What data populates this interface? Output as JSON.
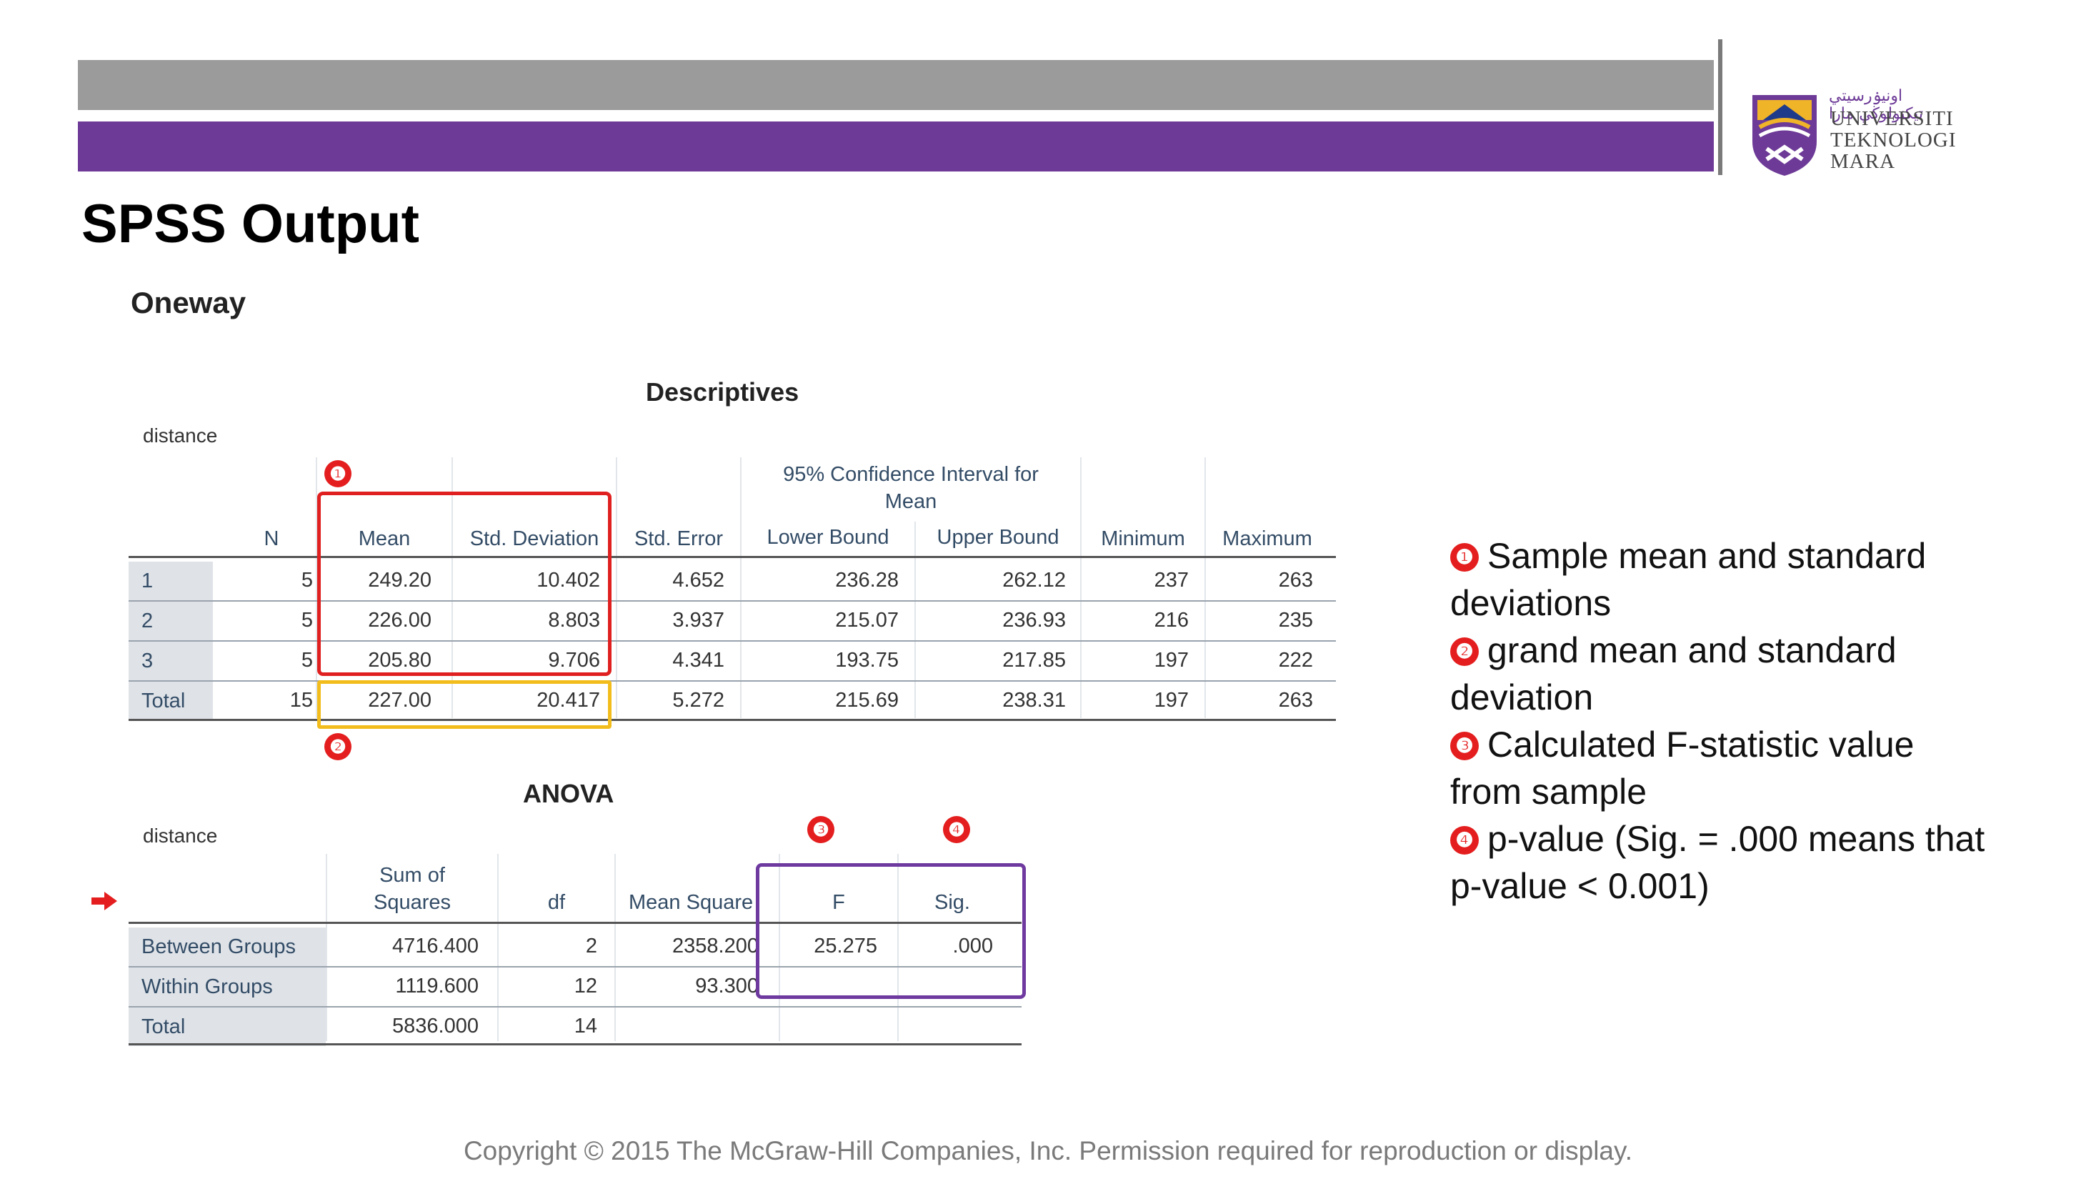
{
  "slide": {
    "title": "SPSS Output"
  },
  "logo": {
    "arabic": "اونيۏرسيتي تيكنولوڬي مارا",
    "line1": "UNIVERSITI",
    "line2": "TEKNOLOGI",
    "line3": "MARA"
  },
  "oneway": {
    "heading": "Oneway"
  },
  "descriptives": {
    "title": "Descriptives",
    "variable": "distance",
    "ci_header": [
      "95% Confidence Interval for",
      "Mean"
    ],
    "columns": [
      "N",
      "Mean",
      "Std. Deviation",
      "Std. Error",
      "Lower Bound",
      "Upper Bound",
      "Minimum",
      "Maximum"
    ],
    "rows": [
      {
        "label": "1",
        "cells": [
          "5",
          "249.20",
          "10.402",
          "4.652",
          "236.28",
          "262.12",
          "237",
          "263"
        ]
      },
      {
        "label": "2",
        "cells": [
          "5",
          "226.00",
          "8.803",
          "3.937",
          "215.07",
          "236.93",
          "216",
          "235"
        ]
      },
      {
        "label": "3",
        "cells": [
          "5",
          "205.80",
          "9.706",
          "4.341",
          "193.75",
          "217.85",
          "197",
          "222"
        ]
      },
      {
        "label": "Total",
        "cells": [
          "15",
          "227.00",
          "20.417",
          "5.272",
          "215.69",
          "238.31",
          "197",
          "263"
        ]
      }
    ]
  },
  "anova": {
    "title": "ANOVA",
    "variable": "distance",
    "columns": [
      [
        "Sum of",
        "Squares"
      ],
      "df",
      "Mean Square",
      "F",
      "Sig."
    ],
    "rows": [
      {
        "label": "Between Groups",
        "cells": [
          "4716.400",
          "2",
          "2358.200",
          "25.275",
          ".000"
        ]
      },
      {
        "label": "Within Groups",
        "cells": [
          "1119.600",
          "12",
          "93.300",
          "",
          ""
        ]
      },
      {
        "label": "Total",
        "cells": [
          "5836.000",
          "14",
          "",
          "",
          ""
        ]
      }
    ]
  },
  "markers": [
    "❶",
    "❷",
    "❸",
    "❹"
  ],
  "notes": [
    {
      "badge": "❶",
      "text": "Sample mean and standard deviations"
    },
    {
      "badge": "❷",
      "text": "grand mean and standard deviation"
    },
    {
      "badge": "❸",
      "text": "Calculated F-statistic value from sample"
    },
    {
      "badge": "❹",
      "text": "p-value (Sig. = .000 means that p-value < 0.001)"
    }
  ],
  "copyright": "Copyright © 2015 The McGraw-Hill Companies, Inc. Permission required for reproduction or display.",
  "colors": {
    "purple": "#6d3a97",
    "gray_bar": "#9b9b9b",
    "red_box": "#e02020",
    "yellow_box": "#f2bd1c",
    "purple_box": "#6f3aa0",
    "marker_red": "#e41e1e"
  }
}
